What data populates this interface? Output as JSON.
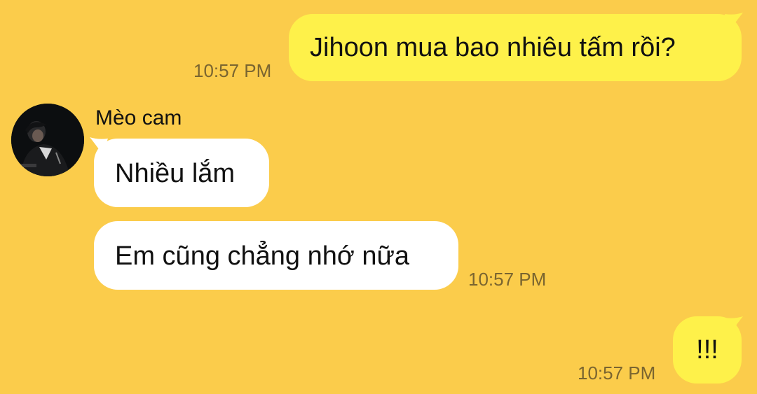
{
  "messages": [
    {
      "direction": "out",
      "text": "Jihoon mua bao nhiêu tấm rồi?",
      "time": "10:57 PM"
    },
    {
      "direction": "in",
      "sender": "Mèo cam",
      "text": "Nhiều lắm"
    },
    {
      "direction": "in",
      "text": "Em cũng chẳng nhớ nữa",
      "time": "10:57 PM"
    },
    {
      "direction": "out",
      "text": "!!!",
      "time": "10:57 PM"
    }
  ],
  "contact": {
    "name": "Mèo cam",
    "avatar_icon": "profile-photo"
  },
  "colors": {
    "background": "#fbcc4b",
    "outgoing_bubble": "#fef14a",
    "incoming_bubble": "#ffffff",
    "timestamp": "#7a6530"
  }
}
